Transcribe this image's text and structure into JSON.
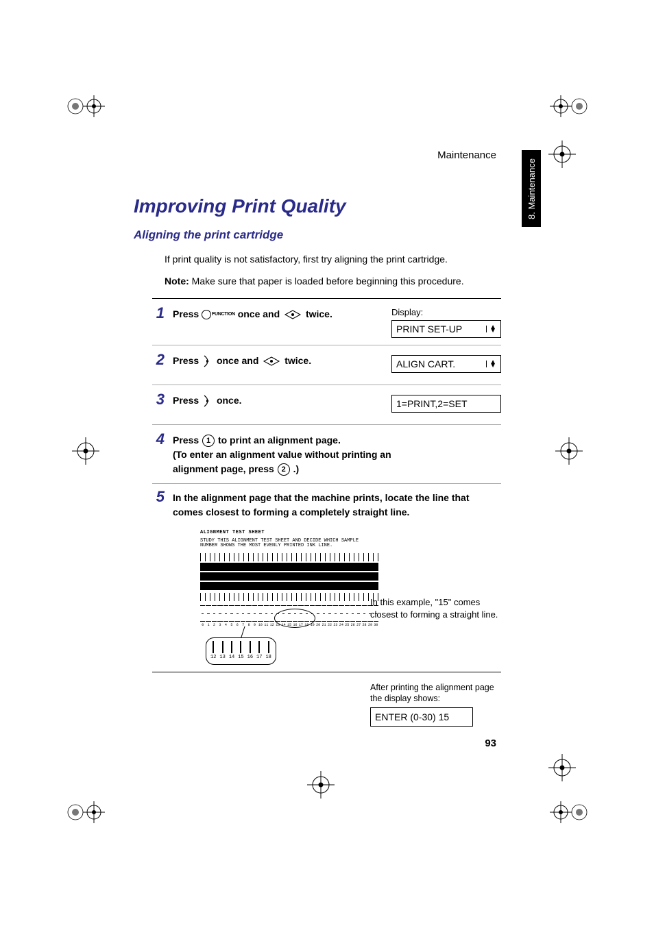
{
  "header": "Maintenance",
  "side_tab": "8. Maintenance",
  "title": "Improving Print Quality",
  "subtitle": "Aligning the print cartridge",
  "intro": "If print quality is not satisfactory, first try aligning the print cartridge.",
  "note_label": "Note:",
  "note_text": " Make sure that paper is loaded before beginning this procedure.",
  "steps": {
    "s1": {
      "num": "1",
      "press": "Press ",
      "function_label": "FUNCTION",
      "mid1": " once and ",
      "mid2": " twice.",
      "display_label": "Display:",
      "display_value": "PRINT SET-UP"
    },
    "s2": {
      "num": "2",
      "press": "Press ",
      "mid1": " once and ",
      "mid2": " twice.",
      "display_value": "ALIGN CART."
    },
    "s3": {
      "num": "3",
      "press": "Press ",
      "mid1": " once.",
      "display_value": "1=PRINT,2=SET"
    },
    "s4": {
      "num": "4",
      "line1a": "Press ",
      "key1": "1",
      "line1b": " to print an alignment page.",
      "line2": "(To enter an alignment value without printing an alignment page, press ",
      "key2": "2",
      "line2b": ".)"
    },
    "s5": {
      "num": "5",
      "text": "In the alignment page that the machine prints, locate the line that comes closest to forming a completely straight line.",
      "sheet_title": "ALIGNMENT TEST SHEET",
      "sheet_sub": "STUDY THIS ALIGNMENT TEST SHEET AND DECIDE WHICH SAMPLE NUMBER SHOWS THE MOST EVENLY PRINTED INK LINE.",
      "example_text": "In this example, \"15\" comes closest to forming a straight line.",
      "after_text": "After printing the alignment page the display shows:",
      "display_value": "ENTER (0-30) 15",
      "mag_values": [
        "12",
        "13",
        "14",
        "15",
        "16",
        "17",
        "18"
      ]
    }
  },
  "sample_numbers": [
    "0",
    "1",
    "2",
    "3",
    "4",
    "5",
    "6",
    "7",
    "8",
    "9",
    "10",
    "11",
    "12",
    "13",
    "14",
    "15",
    "16",
    "17",
    "18",
    "19",
    "20",
    "21",
    "22",
    "23",
    "24",
    "25",
    "26",
    "27",
    "28",
    "29",
    "30"
  ],
  "page_number": "93"
}
